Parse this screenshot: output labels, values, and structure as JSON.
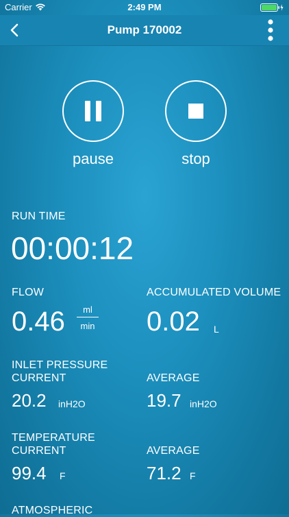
{
  "status_bar": {
    "carrier": "Carrier",
    "time": "2:49 PM"
  },
  "nav": {
    "title": "Pump 170002"
  },
  "controls": {
    "pause_label": "pause",
    "stop_label": "stop"
  },
  "run_time": {
    "label": "RUN TIME",
    "value": "00:00:12"
  },
  "flow": {
    "label": "FLOW",
    "value": "0.46",
    "unit_top": "ml",
    "unit_bottom": "min"
  },
  "accumulated_volume": {
    "label": "ACCUMULATED VOLUME",
    "value": "0.02",
    "unit": "L"
  },
  "inlet_pressure": {
    "label": "INLET PRESSURE",
    "current_label": "CURRENT",
    "current_value": "20.2",
    "current_unit": "inH2O",
    "average_label": "AVERAGE",
    "average_value": "19.7",
    "average_unit": "inH2O"
  },
  "temperature": {
    "label": "TEMPERATURE",
    "current_label": "CURRENT",
    "current_value": "99.4",
    "current_unit": "F",
    "average_label": "AVERAGE",
    "average_value": "71.2",
    "average_unit": "F"
  },
  "atmospheric": {
    "label": "ATMOSPHERIC"
  },
  "colors": {
    "background": "#1c8fbd",
    "navbar": "#1884b2",
    "battery": "#4cd964",
    "text": "#ffffff"
  },
  "icons": {
    "back": "chevron-left-icon",
    "more": "vertical-dots-icon",
    "pause": "pause-icon",
    "stop": "stop-icon",
    "wifi": "wifi-icon",
    "battery": "battery-icon",
    "charging": "bolt-icon"
  }
}
